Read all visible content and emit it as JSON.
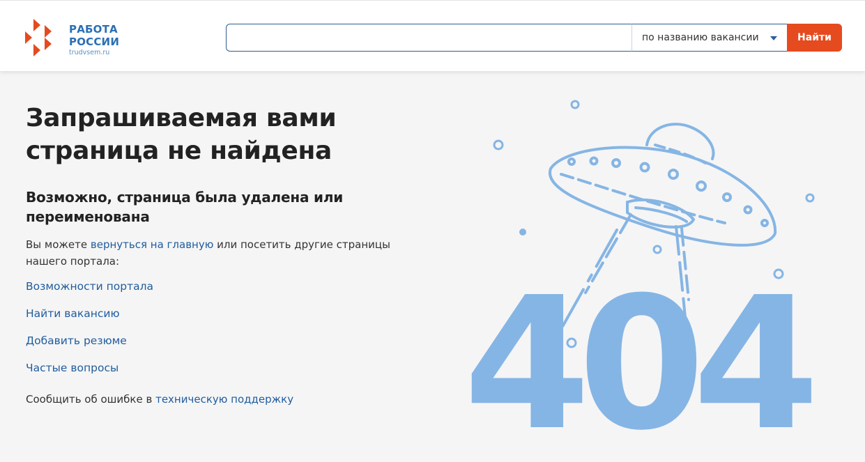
{
  "header": {
    "logo": {
      "line1": "РАБОТА",
      "line2": "РОССИИ",
      "sub": "trudvsem.ru"
    },
    "search": {
      "value": "",
      "placeholder": "",
      "select_value": "по названию вакансии",
      "button_label": "Найти"
    }
  },
  "main": {
    "title": "Запрашиваемая вами страница не найдена",
    "subtitle": "Возможно, страница была удалена или переименована",
    "desc_before": "Вы можете ",
    "home_link": "вернуться на главную",
    "desc_after": " или посетить другие страницы нашего портала:",
    "links": [
      "Возможности портала",
      "Найти вакансию",
      "Добавить резюме",
      "Частые вопросы"
    ],
    "report_before": "Сообщить об ошибке в ",
    "report_link": "техническую поддержку"
  },
  "illustration": {
    "code": "404",
    "color": "#85b5e4",
    "icon": "ufo-icon"
  },
  "colors": {
    "brand_blue": "#2b6fb5",
    "accent_orange": "#e64a1f",
    "link_blue": "#1f5c9c"
  }
}
